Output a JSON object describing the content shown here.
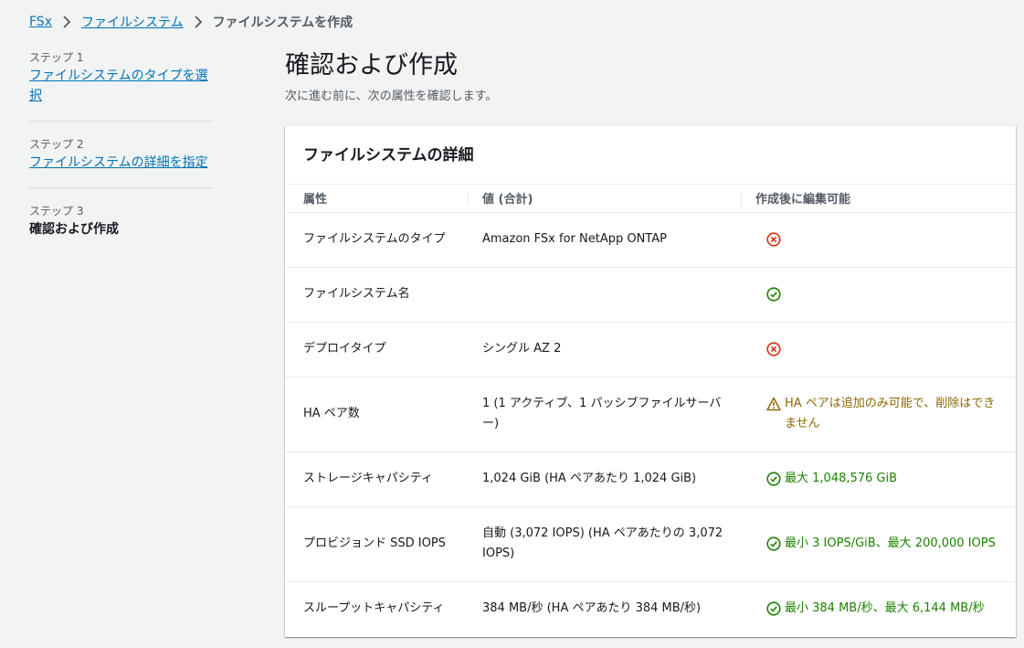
{
  "breadcrumb": {
    "items": [
      "FSx",
      "ファイルシステム"
    ],
    "current": "ファイルシステムを作成"
  },
  "steps": [
    {
      "num": "ステップ 1",
      "label": "ファイルシステムのタイプを選択"
    },
    {
      "num": "ステップ 2",
      "label": "ファイルシステムの詳細を指定"
    },
    {
      "num": "ステップ 3",
      "label": "確認および作成"
    }
  ],
  "page": {
    "title": "確認および作成",
    "description": "次に進む前に、次の属性を確認します。"
  },
  "panel": {
    "title": "ファイルシステムの詳細",
    "columns": [
      "属性",
      "値 (合計)",
      "作成後に編集可能"
    ],
    "rows": [
      {
        "attr": "ファイルシステムのタイプ",
        "value": "Amazon FSx for NetApp ONTAP",
        "editable_icon": "x-circle-icon",
        "editable_text": ""
      },
      {
        "attr": "ファイルシステム名",
        "value": "",
        "editable_icon": "check-circle-icon",
        "editable_text": ""
      },
      {
        "attr": "デプロイタイプ",
        "value": "シングル AZ 2",
        "editable_icon": "x-circle-icon",
        "editable_text": ""
      },
      {
        "attr": "HA ペア数",
        "value": "1 (1 アクティブ、1 パッシブファイルサーバー)",
        "editable_icon": "warning-icon",
        "editable_text": "HA ペアは追加のみ可能で、削除はできません"
      },
      {
        "attr": "ストレージキャパシティ",
        "value": "1,024 GiB (HA ペアあたり 1,024 GiB)",
        "editable_icon": "check-circle-icon",
        "editable_text": "最大 1,048,576 GiB"
      },
      {
        "attr": "プロビジョンド SSD IOPS",
        "value": "自動 (3,072 IOPS) (HA ペアあたりの 3,072 IOPS)",
        "editable_icon": "check-circle-icon",
        "editable_text": "最小 3 IOPS/GiB、最大 200,000 IOPS"
      },
      {
        "attr": "スループットキャパシティ",
        "value": "384 MB/秒 (HA ペアあたり 384 MB/秒)",
        "editable_icon": "check-circle-icon",
        "editable_text": "最小 384 MB/秒、最大 6,144 MB/秒"
      }
    ]
  },
  "colors": {
    "link": "#0073bb",
    "success": "#1d8102",
    "error": "#d13212",
    "warning": "#8d6605"
  }
}
